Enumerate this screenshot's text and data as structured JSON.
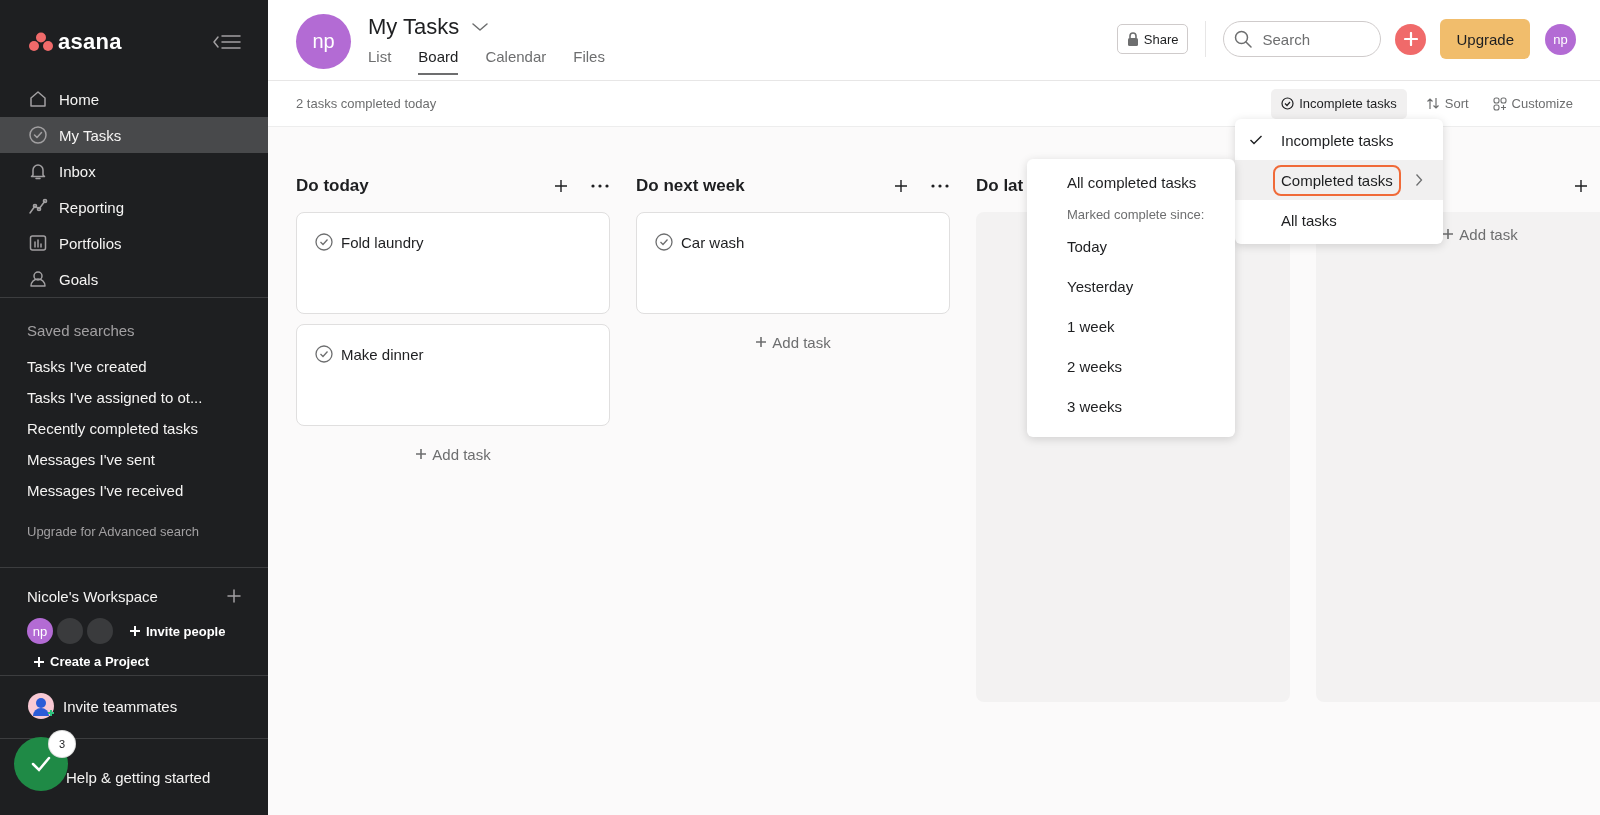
{
  "sidebar": {
    "logo": "asana",
    "nav": [
      {
        "label": "Home",
        "selected": false
      },
      {
        "label": "My Tasks",
        "selected": true
      },
      {
        "label": "Inbox",
        "selected": false
      },
      {
        "label": "Reporting",
        "selected": false
      },
      {
        "label": "Portfolios",
        "selected": false
      },
      {
        "label": "Goals",
        "selected": false
      }
    ],
    "saved_searches": {
      "title": "Saved searches",
      "items": [
        "Tasks I've created",
        "Tasks I've assigned to ot...",
        "Recently completed tasks",
        "Messages I've sent",
        "Messages I've received"
      ],
      "upgrade_link": "Upgrade for Advanced search"
    },
    "workspace": {
      "name": "Nicole's Workspace",
      "members": [
        {
          "kind": "initials",
          "initials": "np"
        },
        {
          "kind": "blank"
        },
        {
          "kind": "blank"
        }
      ],
      "invite_people": "Invite people",
      "create_project": "Create a Project"
    },
    "invite_teammates": "Invite teammates",
    "help": {
      "label": "Help & getting started",
      "badge": "3"
    }
  },
  "header": {
    "avatar": "np",
    "title": "My Tasks",
    "tabs": [
      {
        "label": "List",
        "selected": false
      },
      {
        "label": "Board",
        "selected": true
      },
      {
        "label": "Calendar",
        "selected": false
      },
      {
        "label": "Files",
        "selected": false
      }
    ],
    "share": "Share",
    "search": {
      "placeholder": "Search"
    },
    "upgrade": "Upgrade",
    "user_avatar": "np"
  },
  "toolbar": {
    "status": "2 tasks completed today",
    "filter": "Incomplete tasks",
    "sort": "Sort",
    "customize": "Customize"
  },
  "columns": [
    {
      "kind": "cards",
      "title": "Do today",
      "add_icon": true,
      "more_icon": true,
      "tasks": [
        {
          "name": "Fold laundry"
        },
        {
          "name": "Make dinner"
        }
      ],
      "add_task": "Add task"
    },
    {
      "kind": "cards",
      "title": "Do next week",
      "add_icon": true,
      "more_icon": true,
      "tasks": [
        {
          "name": "Car wash"
        }
      ],
      "add_task": "Add task"
    },
    {
      "kind": "empty",
      "title": "Do lat"
    },
    {
      "kind": "empty",
      "add_icon": true,
      "add_task": "Add task"
    }
  ],
  "filter_menu": {
    "items": [
      {
        "label": "Incomplete tasks",
        "checked": true,
        "selected": false,
        "outlined": false,
        "submenu": false
      },
      {
        "label": "Completed tasks",
        "checked": false,
        "selected": true,
        "outlined": true,
        "submenu": true
      },
      {
        "label": "All tasks",
        "checked": false,
        "selected": false,
        "outlined": false,
        "submenu": false
      }
    ]
  },
  "submenu": {
    "items": [
      {
        "kind": "option",
        "label": "All completed tasks"
      },
      {
        "kind": "heading",
        "label": "Marked complete since:"
      },
      {
        "kind": "option",
        "label": "Today"
      },
      {
        "kind": "option",
        "label": "Yesterday"
      },
      {
        "kind": "option",
        "label": "1 week"
      },
      {
        "kind": "option",
        "label": "2 weeks"
      },
      {
        "kind": "option",
        "label": "3 weeks"
      }
    ]
  }
}
